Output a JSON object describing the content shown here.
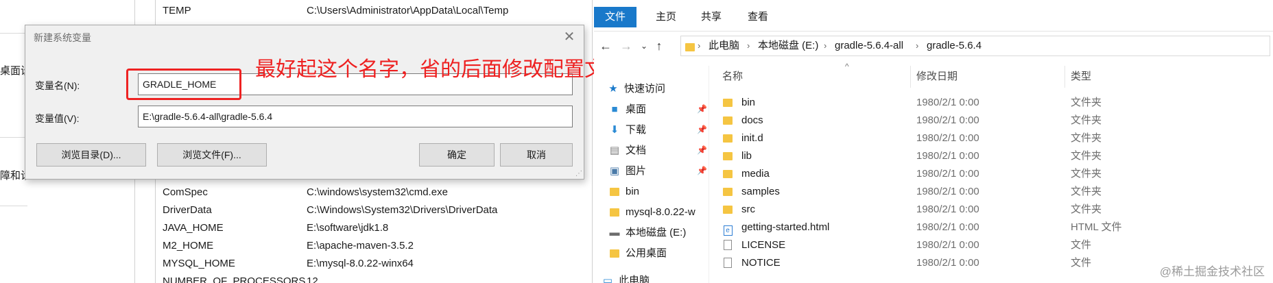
{
  "left_window": {
    "frag1": "桌面设",
    "frag2": "障和诊"
  },
  "env_list": {
    "rows_top": [
      {
        "name": "TEMP",
        "value": "C:\\Users\\Administrator\\AppData\\Local\\Temp"
      }
    ],
    "rows_bottom": [
      {
        "name": "ComSpec",
        "value": "C:\\windows\\system32\\cmd.exe"
      },
      {
        "name": "DriverData",
        "value": "C:\\Windows\\System32\\Drivers\\DriverData"
      },
      {
        "name": "JAVA_HOME",
        "value": "E:\\software\\jdk1.8"
      },
      {
        "name": "M2_HOME",
        "value": "E:\\apache-maven-3.5.2"
      },
      {
        "name": "MYSQL_HOME",
        "value": "E:\\mysql-8.0.22-winx64"
      },
      {
        "name": "NUMBER_OF_PROCESSORS",
        "value": "12"
      }
    ]
  },
  "dialog": {
    "title": "新建系统变量",
    "name_label": "变量名(N):",
    "name_value": "GRADLE_HOME",
    "value_label": "变量值(V):",
    "value_value": "E:\\gradle-5.6.4-all\\gradle-5.6.4",
    "browse_dir": "浏览目录(D)...",
    "browse_file": "浏览文件(F)...",
    "ok": "确定",
    "cancel": "取消"
  },
  "annotation": {
    "text": "最好起这个名字，省的后面修改配置文件名称",
    "color": "#ee2020"
  },
  "explorer": {
    "tabs": [
      "文件",
      "主页",
      "共享",
      "查看"
    ],
    "breadcrumb": [
      "此电脑",
      "本地磁盘 (E:)",
      "gradle-5.6.4-all",
      "gradle-5.6.4"
    ],
    "nav": {
      "quick_access": "快速访问",
      "items": [
        {
          "label": "桌面",
          "icon": "desktop-icon",
          "pinned": true
        },
        {
          "label": "下载",
          "icon": "download-icon",
          "pinned": true
        },
        {
          "label": "文档",
          "icon": "documents-icon",
          "pinned": true
        },
        {
          "label": "图片",
          "icon": "pictures-icon",
          "pinned": true
        },
        {
          "label": "bin",
          "icon": "folder-icon",
          "pinned": false
        },
        {
          "label": "mysql-8.0.22-w",
          "icon": "folder-icon",
          "pinned": false
        },
        {
          "label": "本地磁盘 (E:)",
          "icon": "drive-icon",
          "pinned": false
        },
        {
          "label": "公用桌面",
          "icon": "folder-icon",
          "pinned": false
        }
      ],
      "this_pc": "此电脑"
    },
    "columns": {
      "name": "名称",
      "date": "修改日期",
      "type": "类型"
    },
    "files": [
      {
        "name": "bin",
        "date": "1980/2/1 0:00",
        "type": "文件夹",
        "kind": "folder"
      },
      {
        "name": "docs",
        "date": "1980/2/1 0:00",
        "type": "文件夹",
        "kind": "folder"
      },
      {
        "name": "init.d",
        "date": "1980/2/1 0:00",
        "type": "文件夹",
        "kind": "folder"
      },
      {
        "name": "lib",
        "date": "1980/2/1 0:00",
        "type": "文件夹",
        "kind": "folder"
      },
      {
        "name": "media",
        "date": "1980/2/1 0:00",
        "type": "文件夹",
        "kind": "folder"
      },
      {
        "name": "samples",
        "date": "1980/2/1 0:00",
        "type": "文件夹",
        "kind": "folder"
      },
      {
        "name": "src",
        "date": "1980/2/1 0:00",
        "type": "文件夹",
        "kind": "folder"
      },
      {
        "name": "getting-started.html",
        "date": "1980/2/1 0:00",
        "type": "HTML 文件",
        "kind": "html"
      },
      {
        "name": "LICENSE",
        "date": "1980/2/1 0:00",
        "type": "文件",
        "kind": "file"
      },
      {
        "name": "NOTICE",
        "date": "1980/2/1 0:00",
        "type": "文件",
        "kind": "file"
      }
    ]
  },
  "watermark": "@稀土掘金技术社区",
  "colors": {
    "accent": "#1979ca",
    "folder": "#f5c542",
    "annotation": "#ee2222"
  }
}
